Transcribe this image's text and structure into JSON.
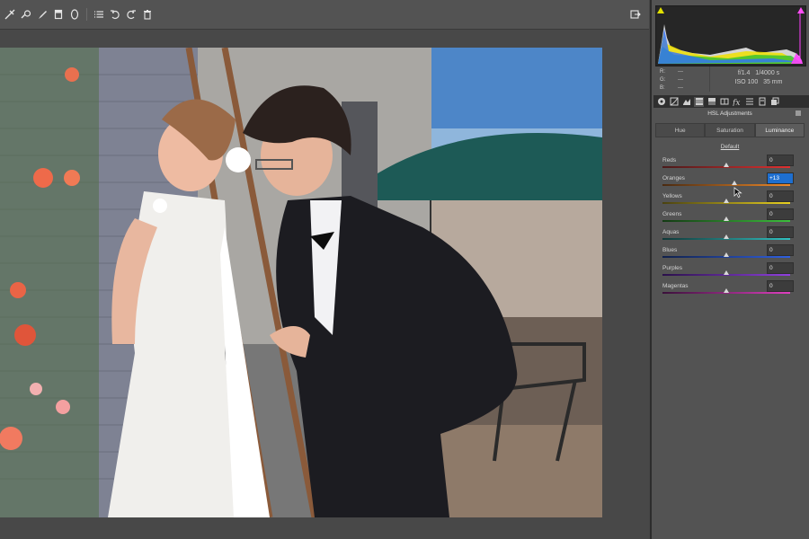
{
  "toolbar": {
    "tools": [
      "straighten-icon",
      "red-eye-icon",
      "brush-icon",
      "graduated-filter-icon",
      "radial-filter-icon",
      "list-icon",
      "rotate-left-icon",
      "rotate-right-icon",
      "trash-icon"
    ]
  },
  "readout": {
    "r_label": "R:",
    "g_label": "G:",
    "b_label": "B:",
    "r_val": "---",
    "g_val": "---",
    "b_val": "---",
    "aperture": "f/1.4",
    "shutter": "1/4000 s",
    "iso": "ISO 100",
    "focal": "35 mm"
  },
  "panel": {
    "title": "HSL Adjustments",
    "tabs": [
      "Hue",
      "Saturation",
      "Luminance"
    ],
    "active_tab": "Luminance",
    "default_label": "Default"
  },
  "sliders": [
    {
      "name": "Reds",
      "value": "0",
      "level": 0
    },
    {
      "name": "Oranges",
      "value": "+13",
      "level": 13
    },
    {
      "name": "Yellows",
      "value": "0",
      "level": 0
    },
    {
      "name": "Greens",
      "value": "0",
      "level": 0
    },
    {
      "name": "Aquas",
      "value": "0",
      "level": 0
    },
    {
      "name": "Blues",
      "value": "0",
      "level": 0
    },
    {
      "name": "Purples",
      "value": "0",
      "level": 0
    },
    {
      "name": "Magentas",
      "value": "0",
      "level": 0
    }
  ],
  "colors": {
    "panel_bg": "#535353",
    "value_highlight": "#1e6fd0",
    "clip_shadow": "#e0e000",
    "clip_highlight": "#ff4df6"
  }
}
